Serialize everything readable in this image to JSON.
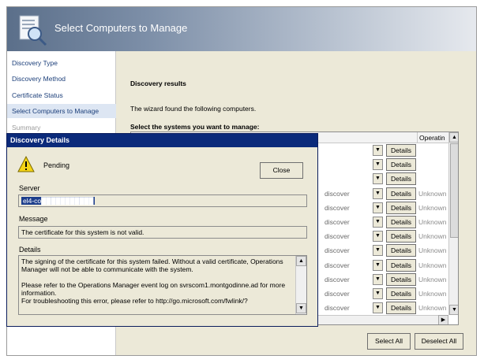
{
  "wizard": {
    "title": "Select Computers to Manage",
    "nav": [
      {
        "label": "Discovery Type",
        "state": "link"
      },
      {
        "label": "Discovery Method",
        "state": "link"
      },
      {
        "label": "Certificate Status",
        "state": "link"
      },
      {
        "label": "Select Computers to Manage",
        "state": "selected"
      },
      {
        "label": "Summary",
        "state": "disabled"
      }
    ],
    "main": {
      "section_title": "Discovery results",
      "found_text": "The wizard found the following computers.",
      "select_label": "Select the systems you want to manage:",
      "grid": {
        "column_operation": "Operatin",
        "rows": [
          {
            "operation": "",
            "details_label": "Details",
            "result": ""
          },
          {
            "operation": "",
            "details_label": "Details",
            "result": ""
          },
          {
            "operation": "",
            "details_label": "Details",
            "result": ""
          },
          {
            "operation": "discover",
            "details_label": "Details",
            "result": "Unknown"
          },
          {
            "operation": "discover",
            "details_label": "Details",
            "result": "Unknown"
          },
          {
            "operation": "discover",
            "details_label": "Details",
            "result": "Unknown"
          },
          {
            "operation": "discover",
            "details_label": "Details",
            "result": "Unknown"
          },
          {
            "operation": "discover",
            "details_label": "Details",
            "result": "Unknown"
          },
          {
            "operation": "discover",
            "details_label": "Details",
            "result": "Unknown"
          },
          {
            "operation": "discover",
            "details_label": "Details",
            "result": "Unknown"
          },
          {
            "operation": "discover",
            "details_label": "Details",
            "result": "Unknown"
          },
          {
            "operation": "discover",
            "details_label": "Details",
            "result": "Unknown"
          }
        ]
      },
      "select_all_label": "Select All",
      "deselect_all_label": "Deselect All"
    }
  },
  "dialog": {
    "title": "Discovery Details",
    "status": "Pending",
    "close_label": "Close",
    "server_label": "Server",
    "server_value": "el4-co███████████",
    "message_label": "Message",
    "message_value": "The certificate for this system is not valid.",
    "details_label": "Details",
    "details_text": "The signing of the certificate for this system failed. Without a valid certificate, Operations Manager will not be able to communicate with the system.\n\nPlease refer to the Operations Manager event log on svrscom1.montgodinne.ad for more information.\nFor troubleshooting this error, please refer to http://go.microsoft.com/fwlink/?"
  },
  "icons": {
    "header": "wizard-search-icon",
    "warning": "warning-icon",
    "dropdown": "chevron-down-icon"
  },
  "colors": {
    "dialog_title": "#0b2a7a",
    "nav_link": "#1c3f7a",
    "selected_nav": "#dde6f3"
  }
}
